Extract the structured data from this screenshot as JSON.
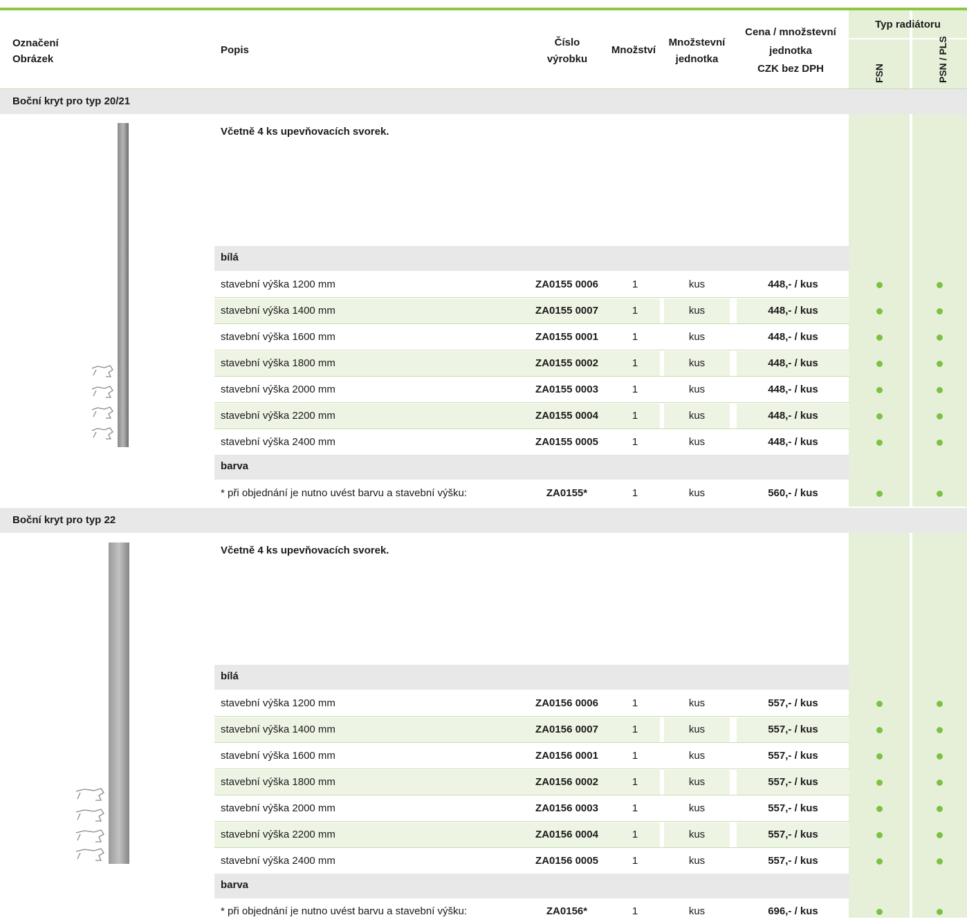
{
  "header": {
    "oznaceni": "Označení",
    "obrazek": "Obrázek",
    "popis": "Popis",
    "cislo_1": "Číslo",
    "cislo_2": "výrobku",
    "mnozstvi": "Množství",
    "mj_1": "Množstevní",
    "mj_2": "jednotka",
    "cena_1": "Cena / množstevní",
    "cena_2": "jednotka",
    "cena_3": "CZK bez DPH",
    "typ": "Typ radiátoru",
    "fsn": "FSN",
    "psn": "PSN / PLS"
  },
  "colors": {
    "accent": "#8dc63f",
    "dot": "#7dc142",
    "light_green": "#e6f0d9",
    "grey": "#e8e8e8"
  },
  "sections": [
    {
      "title": "Boční kryt pro typ 20/21",
      "intro": "Včetně 4 ks upevňovacích svorek.",
      "group_white": "bílá",
      "rows": [
        {
          "desc": "stavební výška 1200 mm",
          "code": "ZA0155 0006",
          "qty": "1",
          "unit": "kus",
          "price": "448,- / kus"
        },
        {
          "desc": "stavební výška 1400 mm",
          "code": "ZA0155 0007",
          "qty": "1",
          "unit": "kus",
          "price": "448,- / kus"
        },
        {
          "desc": "stavební výška 1600 mm",
          "code": "ZA0155 0001",
          "qty": "1",
          "unit": "kus",
          "price": "448,- / kus"
        },
        {
          "desc": "stavební výška 1800 mm",
          "code": "ZA0155 0002",
          "qty": "1",
          "unit": "kus",
          "price": "448,- / kus"
        },
        {
          "desc": "stavební výška 2000 mm",
          "code": "ZA0155 0003",
          "qty": "1",
          "unit": "kus",
          "price": "448,- / kus"
        },
        {
          "desc": "stavební výška 2200 mm",
          "code": "ZA0155 0004",
          "qty": "1",
          "unit": "kus",
          "price": "448,- / kus"
        },
        {
          "desc": "stavební výška 2400 mm",
          "code": "ZA0155 0005",
          "qty": "1",
          "unit": "kus",
          "price": "448,- / kus"
        }
      ],
      "group_color": "barva",
      "color_row": {
        "desc": "* při objednání je nutno uvést barvu a stavební výšku:",
        "code": "ZA0155*",
        "qty": "1",
        "unit": "kus",
        "price": "560,- / kus"
      }
    },
    {
      "title": "Boční kryt pro typ 22",
      "intro": "Včetně 4 ks upevňovacích svorek.",
      "group_white": "bílá",
      "rows": [
        {
          "desc": "stavební výška 1200 mm",
          "code": "ZA0156 0006",
          "qty": "1",
          "unit": "kus",
          "price": "557,- / kus"
        },
        {
          "desc": "stavební výška 1400 mm",
          "code": "ZA0156 0007",
          "qty": "1",
          "unit": "kus",
          "price": "557,- / kus"
        },
        {
          "desc": "stavební výška 1600 mm",
          "code": "ZA0156 0001",
          "qty": "1",
          "unit": "kus",
          "price": "557,- / kus"
        },
        {
          "desc": "stavební výška 1800 mm",
          "code": "ZA0156 0002",
          "qty": "1",
          "unit": "kus",
          "price": "557,- / kus"
        },
        {
          "desc": "stavební výška 2000 mm",
          "code": "ZA0156 0003",
          "qty": "1",
          "unit": "kus",
          "price": "557,- / kus"
        },
        {
          "desc": "stavební výška 2200 mm",
          "code": "ZA0156 0004",
          "qty": "1",
          "unit": "kus",
          "price": "557,- / kus"
        },
        {
          "desc": "stavební výška 2400 mm",
          "code": "ZA0156 0005",
          "qty": "1",
          "unit": "kus",
          "price": "557,- / kus"
        }
      ],
      "group_color": "barva",
      "color_row": {
        "desc": "* při objednání je nutno uvést barvu a stavební výšku:",
        "code": "ZA0156*",
        "qty": "1",
        "unit": "kus",
        "price": "696,- / kus"
      }
    }
  ]
}
